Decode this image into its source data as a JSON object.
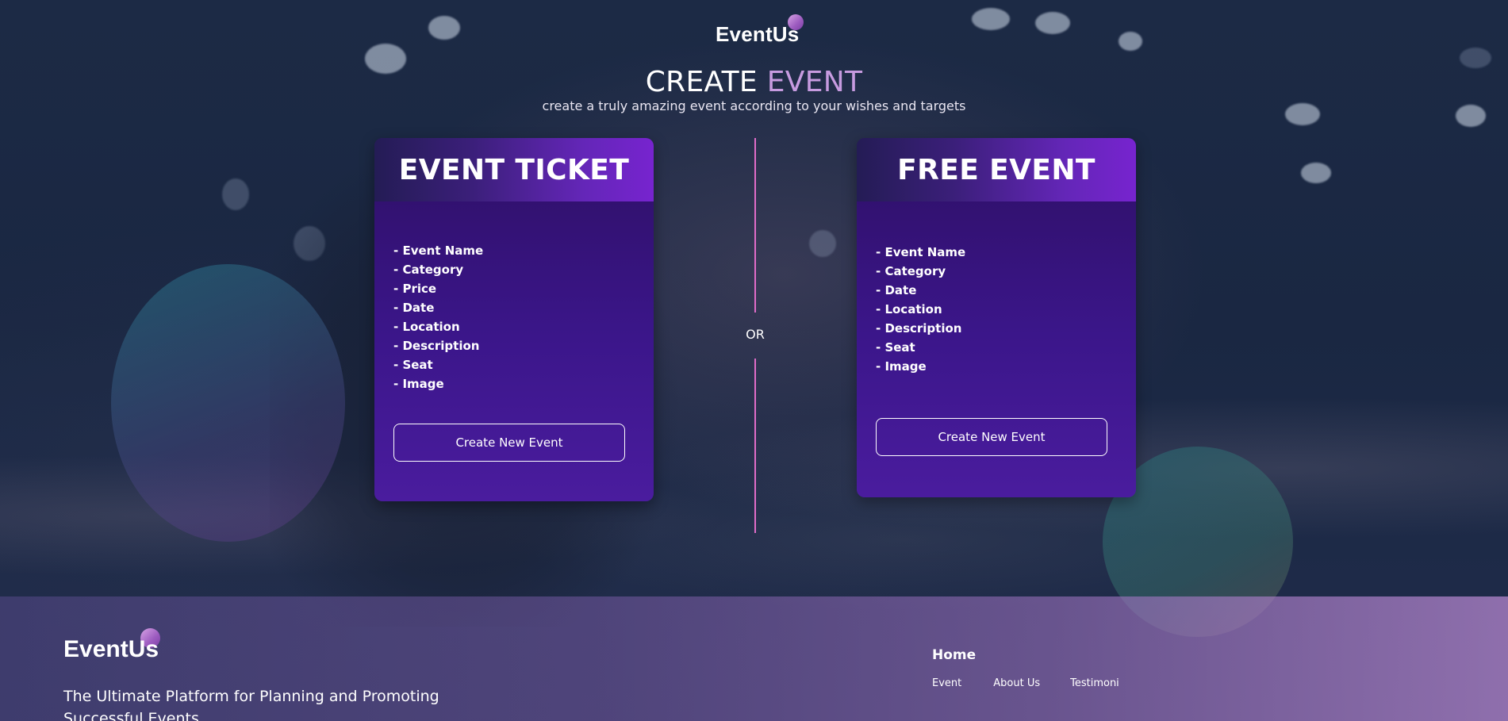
{
  "header": {
    "logo": "EventUs",
    "title_main": "CREATE ",
    "title_accent": "EVENT",
    "subtitle": "create a truly amazing event according to your wishes and targets"
  },
  "colors": {
    "accent": "#c79be0",
    "divider": "#e06cc8",
    "card_background": "#3b168a",
    "card_header_end": "#7724cf"
  },
  "cards": [
    {
      "title": "EVENT TICKET",
      "fields": [
        "- Event Name",
        "- Category",
        "- Price",
        "- Date",
        "- Location",
        "- Description",
        "- Seat",
        "- Image"
      ],
      "button_label": "Create New Event"
    },
    {
      "title": "FREE EVENT",
      "fields": [
        "- Event Name",
        "- Category",
        "- Date",
        "- Location",
        "- Description",
        "- Seat",
        "- Image"
      ],
      "button_label": "Create New Event"
    }
  ],
  "divider": {
    "label": "OR"
  },
  "footer": {
    "logo": "EventUs",
    "tagline": "The Ultimate Platform for Planning and Promoting Successful Events",
    "nav_heading": "Home",
    "links": [
      "Event",
      "About Us",
      "Testimoni"
    ]
  }
}
